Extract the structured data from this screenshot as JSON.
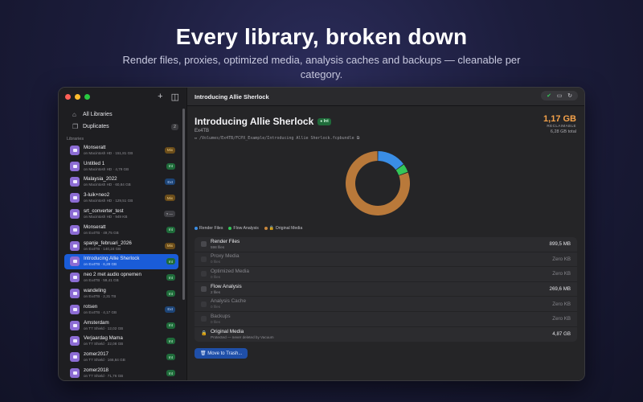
{
  "hero": {
    "title": "Every library, broken down",
    "subtitle": "Render files, proxies, optimized media, analysis caches and backups — cleanable per category."
  },
  "sidebar": {
    "toolbar": {
      "add_icon": "plus-icon",
      "sidebar_icon": "sidebar-toggle-icon"
    },
    "nav": [
      {
        "label": "All Libraries",
        "icon": "home-icon"
      },
      {
        "label": "Duplicates",
        "icon": "duplicate-icon",
        "count": "2"
      }
    ],
    "section_label": "Libraries",
    "libraries": [
      {
        "name": "Monseratt",
        "meta": "on Macintosh HD · 151,81 GB",
        "badge": "Mix",
        "kind": "mix"
      },
      {
        "name": "Untitled 1",
        "meta": "on Macintosh HD · 4,79 GB",
        "badge": "Int",
        "kind": "int"
      },
      {
        "name": "Malaysia_2022",
        "meta": "on Macintosh HD · 60,84 GB",
        "badge": "Ext",
        "kind": "ext"
      },
      {
        "name": "3-luik+neo2",
        "meta": "on Macintosh HD · 129,51 GB",
        "badge": "Mix",
        "kind": "mix"
      },
      {
        "name": "srt_converter_test",
        "meta": "on Macintosh HD · 949 KB",
        "badge": "? —",
        "kind": "unk"
      },
      {
        "name": "Monseratt",
        "meta": "on Ex4TB · 49,75 GB",
        "badge": "Int",
        "kind": "int"
      },
      {
        "name": "spanje_februari_2026",
        "meta": "on Ex4TB · 140,24 GB",
        "badge": "Mix",
        "kind": "mix"
      },
      {
        "name": "Introducing Allie Sherlock",
        "meta": "on Ex4TB · 6,28 GB",
        "badge": "Int",
        "kind": "int",
        "selected": true
      },
      {
        "name": "neo 2 met audio opnemen",
        "meta": "on Ex4TB · 59,41 GB",
        "badge": "Int",
        "kind": "int"
      },
      {
        "name": "wandeling",
        "meta": "on Ex4TB · 2,31 TB",
        "badge": "Int",
        "kind": "int"
      },
      {
        "name": "rotsen",
        "meta": "on Ex4TB · 4,17 GB",
        "badge": "Ext",
        "kind": "ext"
      },
      {
        "name": "Amsterdam",
        "meta": "on T7 Shield · 12,02 GB",
        "badge": "Int",
        "kind": "int"
      },
      {
        "name": "Verjaardag Mama",
        "meta": "on T7 Shield · 22,08 GB",
        "badge": "Int",
        "kind": "int"
      },
      {
        "name": "zomer2017",
        "meta": "on T7 Shield · 166,84 GB",
        "badge": "Int",
        "kind": "int"
      },
      {
        "name": "zomer2018",
        "meta": "on T7 Shield · 71,76 GB",
        "badge": "Int",
        "kind": "int"
      }
    ]
  },
  "main": {
    "window_title": "Introducing Allie Sherlock",
    "toolbar_icons": [
      "clean-check-icon",
      "folder-icon",
      "refresh-icon"
    ],
    "library_title": "Introducing Allie Sherlock",
    "library_badge": "Int",
    "volume": "Ex4TB",
    "path": "/Volumes/Ex4TB/FCPX_Example/Introducing Allie Sherlock.fcpbundle",
    "reclaimable_size": "1,17 GB",
    "reclaimable_label": "RECLAIMABLE",
    "total_label": "6,28 GB total",
    "legend": [
      {
        "label": "Render Files",
        "color": "#3a8ee6"
      },
      {
        "label": "Flow Analysis",
        "color": "#34c759"
      },
      {
        "label": "Original Media",
        "color": "#c9873d",
        "icon": "lock-icon"
      }
    ],
    "categories": [
      {
        "name": "Render Files",
        "sub": "598 files",
        "size": "899,5 MB",
        "active": true,
        "checkbox": "■"
      },
      {
        "name": "Proxy Media",
        "sub": "0 files",
        "size": "Zero KB",
        "active": false
      },
      {
        "name": "Optimized Media",
        "sub": "0 files",
        "size": "Zero KB",
        "active": false
      },
      {
        "name": "Flow Analysis",
        "sub": "2 files",
        "size": "269,6 MB",
        "active": true,
        "checkbox": "■"
      },
      {
        "name": "Analysis Cache",
        "sub": "0 files",
        "size": "Zero KB",
        "active": false
      },
      {
        "name": "Backups",
        "sub": "0 files",
        "size": "Zero KB",
        "active": false
      },
      {
        "name": "Original Media",
        "sub": "Protected — never deleted by Vacuum",
        "size": "4,87 GB",
        "active": true,
        "locked": true
      }
    ],
    "trash_button": "Move to Trash..."
  },
  "chart_data": {
    "type": "pie",
    "categories": [
      "Render Files",
      "Flow Analysis",
      "Original Media"
    ],
    "values": [
      899.5,
      269.6,
      4870
    ],
    "colors": [
      "#3a8ee6",
      "#34c759",
      "#b9793a"
    ]
  }
}
